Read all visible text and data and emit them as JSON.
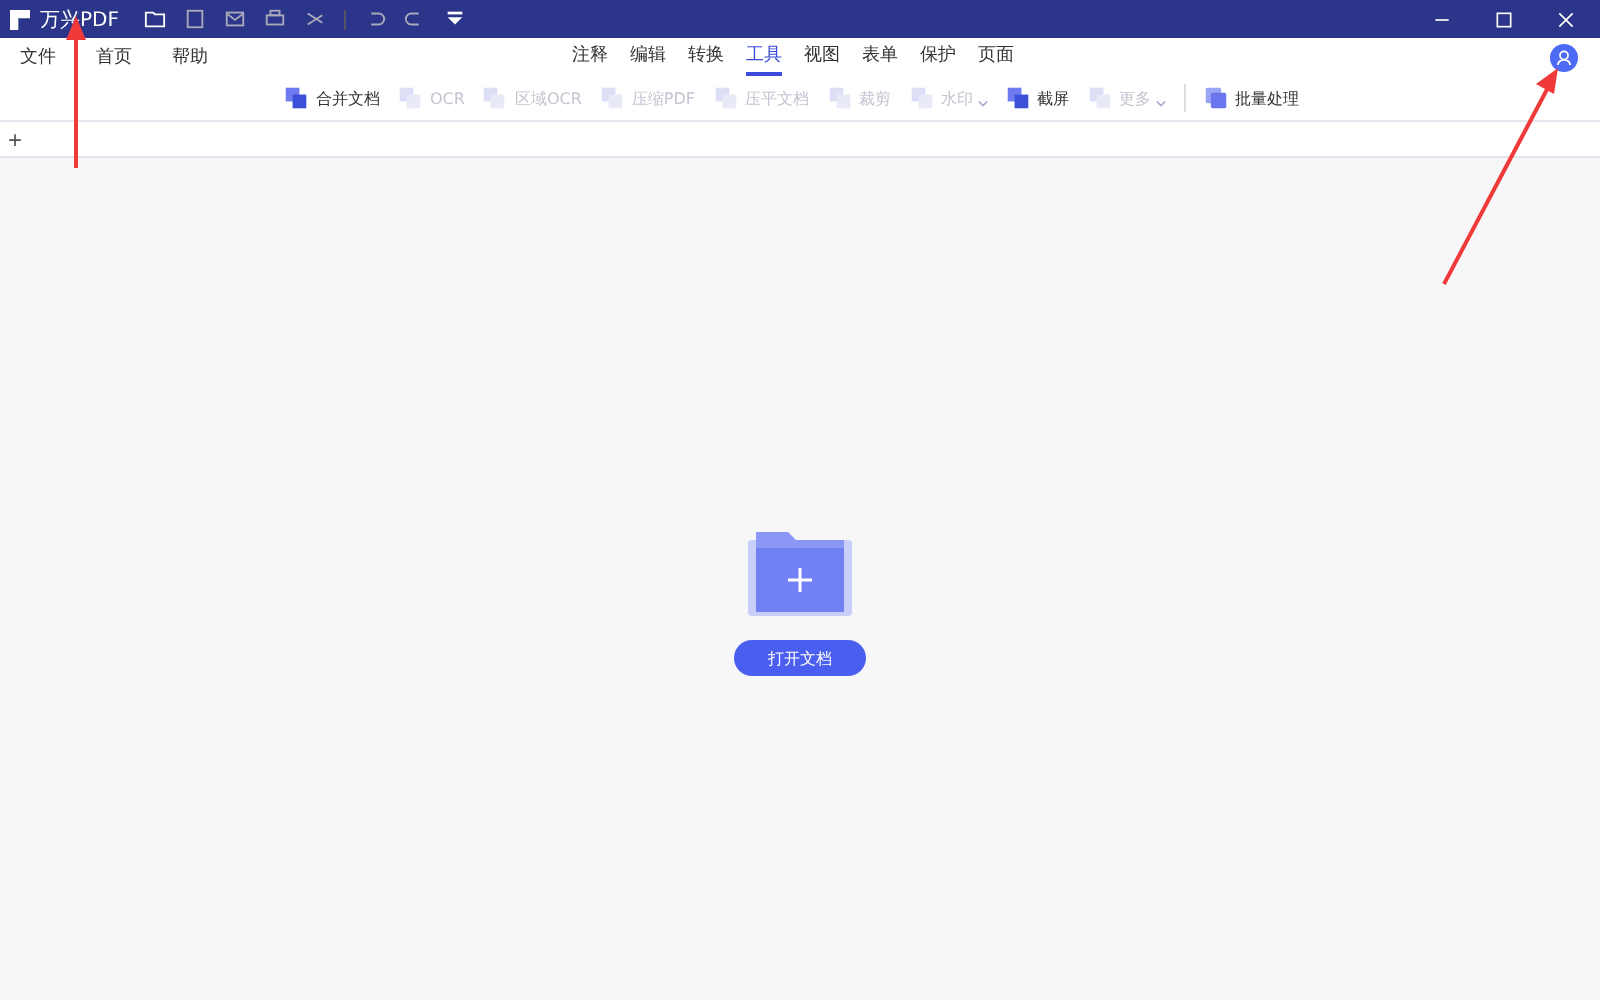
{
  "window": {
    "title": "万兴PDF"
  },
  "menu": [
    {
      "label": "文件"
    },
    {
      "label": "首页"
    },
    {
      "label": "帮助"
    }
  ],
  "tabs": [
    {
      "label": "注释",
      "selected": false
    },
    {
      "label": "编辑",
      "selected": false
    },
    {
      "label": "转换",
      "selected": false
    },
    {
      "label": "工具",
      "selected": true
    },
    {
      "label": "视图",
      "selected": false
    },
    {
      "label": "表单",
      "selected": false
    },
    {
      "label": "保护",
      "selected": false
    },
    {
      "label": "页面",
      "selected": false
    }
  ],
  "tools": [
    {
      "label": "合并文档",
      "disabled": false,
      "dropdown": false
    },
    {
      "label": "OCR",
      "disabled": true,
      "dropdown": false
    },
    {
      "label": "区域OCR",
      "disabled": true,
      "dropdown": false
    },
    {
      "label": "压缩PDF",
      "disabled": true,
      "dropdown": false
    },
    {
      "label": "压平文档",
      "disabled": true,
      "dropdown": false
    },
    {
      "label": "裁剪",
      "disabled": true,
      "dropdown": false
    },
    {
      "label": "水印",
      "disabled": true,
      "dropdown": true
    },
    {
      "label": "截屏",
      "disabled": false,
      "dropdown": false
    },
    {
      "label": "更多",
      "disabled": true,
      "dropdown": true
    }
  ],
  "batch": {
    "label": "批量处理"
  },
  "new_tab": "+",
  "open_button": "打开文档"
}
